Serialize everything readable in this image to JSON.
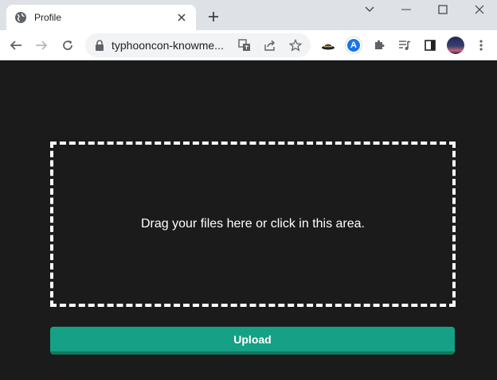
{
  "browser": {
    "tab": {
      "title": "Profile"
    },
    "address_bar": {
      "url": "typhooncon-knowme..."
    },
    "extension_badge": "A"
  },
  "page": {
    "dropzone_text": "Drag your files here or click in this area.",
    "upload_label": "Upload"
  },
  "colors": {
    "page_background": "#1b1b1b",
    "upload_button": "#16a085",
    "dropzone_border": "#ffffff"
  }
}
